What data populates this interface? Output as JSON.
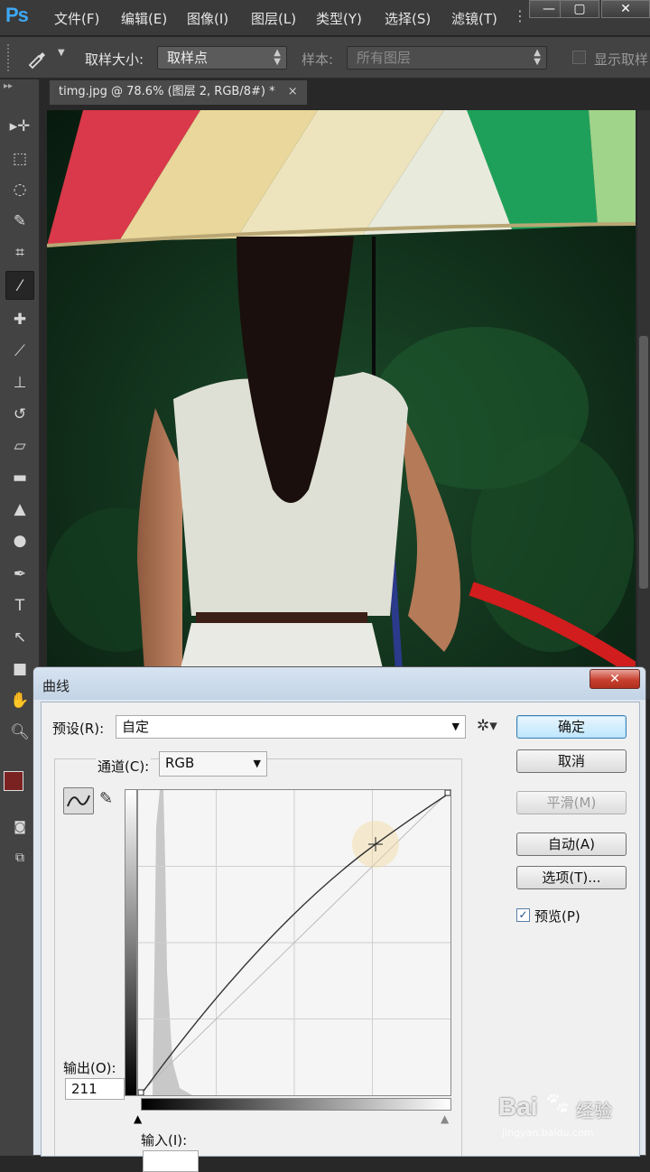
{
  "app": {
    "logo": "Ps"
  },
  "menu": [
    "文件(F)",
    "编辑(E)",
    "图像(I)",
    "图层(L)",
    "类型(Y)",
    "选择(S)",
    "滤镜(T)"
  ],
  "options": {
    "sample_size_label": "取样大小:",
    "sample_size_value": "取样点",
    "sample_label": "样本:",
    "sample_value": "所有图层",
    "show_ring_label": "显示取样"
  },
  "document": {
    "tab_title": "timg.jpg @ 78.6% (图层 2, RGB/8#) *",
    "close": "×"
  },
  "dialog": {
    "title": "曲线",
    "close": "✕",
    "preset_label": "预设(R):",
    "preset_value": "自定",
    "channel_label": "通道(C):",
    "channel_value": "RGB",
    "output_label": "输出(O):",
    "output_value": "211",
    "input_label": "输入(I):",
    "buttons": {
      "ok": "确定",
      "cancel": "取消",
      "smooth": "平滑(M)",
      "auto": "自动(A)",
      "options": "选项(T)..."
    },
    "preview_label": "预览(P)",
    "preview_checked": true
  },
  "watermark": {
    "brand": "Bai",
    "cn": "经验",
    "url": "jingyan.baidu.com"
  }
}
